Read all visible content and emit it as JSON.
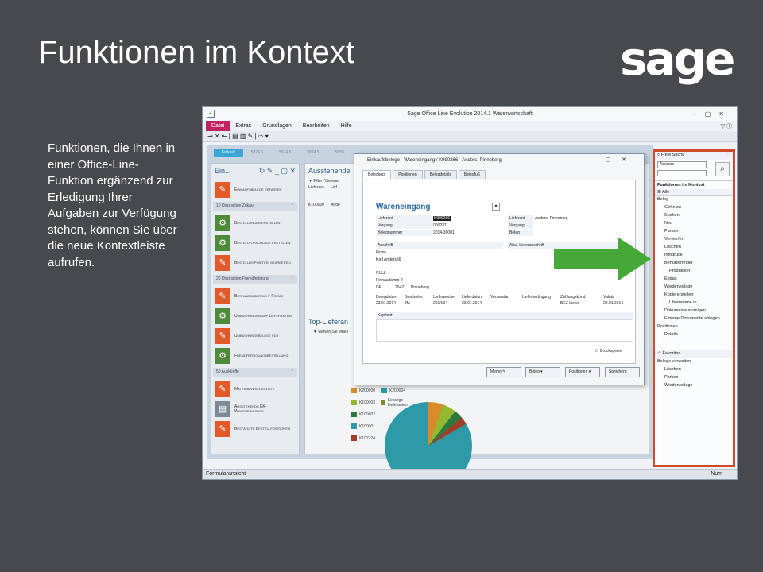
{
  "slide": {
    "title": "Funktionen im Kontext",
    "logo": "sage",
    "text": "Funktionen, die Ihnen in einer Office-Line-Funktion ergänzend zur Erledigung Ihrer Aufgaben zur Verfügung stehen, können Sie über die neue Kontextleiste aufrufen."
  },
  "app": {
    "title": "Sage Office Line Evolution 2014.1 Warenwirtschaft",
    "menu": [
      "Datei",
      "Extras",
      "Grundlagen",
      "Bearbeiten",
      "Hilfe"
    ],
    "status_left": "Formularansicht",
    "status_right": "Num"
  },
  "workarea": {
    "tabs": [
      "Einkauf",
      "5874.5",
      "5874.5",
      "5874.5",
      "5888"
    ],
    "left_panel": {
      "title": "Ein...",
      "top_tile": "Einkaufsbelege erfassen",
      "groups": [
        {
          "label": "10 Disposition Zukauf",
          "items": [
            "Bestellungen erstellen",
            "Bestellvorschläge erstellen",
            "Bestelldisposition bearbeiten"
          ]
        },
        {
          "label": "20 Disposition Fremdfertigung",
          "items": [
            "Bestandsübersicht Fremd",
            "Umbuchungen auf Lieferanten",
            "Umbuchungsbelege für",
            "Fremdfertigungsbestellung"
          ]
        },
        {
          "label": "50 Auskünfte",
          "items": [
            "Materialverzugsliste",
            "Ausstehende EK-Wareneingänge",
            "Bestätigte Bestellpositionen"
          ]
        }
      ]
    },
    "mid_panel": {
      "title": "Ausstehende",
      "filter": "Filter: 'Lieferan",
      "col_lieferant": "Lieferant",
      "col_lief": "Lief",
      "row_id": "K100000",
      "row_name": "Ande",
      "title2": "Top-Lieferan",
      "select_hint": "wählen Sie einen"
    },
    "legend": [
      [
        "K200000",
        "K200004"
      ],
      [
        "K100003",
        "Sonstige Lieferanten"
      ],
      [
        "K100002",
        ""
      ],
      [
        "K100001",
        ""
      ],
      [
        "K102224",
        ""
      ]
    ],
    "legend_colors": [
      [
        "#d98b2b",
        "#2e9aa8"
      ],
      [
        "#93b832",
        "#7d8a2a"
      ],
      [
        "#2e7a3c",
        ""
      ],
      [
        "#2e9aa8",
        ""
      ],
      [
        "#a43c2a",
        ""
      ]
    ]
  },
  "sidebar": {
    "search_head": "Freie Suche",
    "search_select": "Adresse",
    "context_head": "Funktionen im Kontext",
    "alle": "Alle",
    "items": [
      {
        "label": "Beleg",
        "level": 0
      },
      {
        "label": "Gehe zu",
        "level": 1
      },
      {
        "label": "Suchen",
        "level": 1
      },
      {
        "label": "Neu",
        "level": 1
      },
      {
        "label": "Parken",
        "level": 1
      },
      {
        "label": "Verwerfen",
        "level": 1
      },
      {
        "label": "Löschen",
        "level": 1
      },
      {
        "label": "Infodruck",
        "level": 1
      },
      {
        "label": "Benutzerfelder",
        "level": 1
      },
      {
        "label": "Produktion",
        "level": 2
      },
      {
        "label": "Extras",
        "level": 1
      },
      {
        "label": "Wiedervorlage",
        "level": 1
      },
      {
        "label": "Kopie erstellen",
        "level": 1
      },
      {
        "label": "Übernahme in",
        "level": 2
      },
      {
        "label": "Dokumente anzeigen",
        "level": 1
      },
      {
        "label": "Externe Dokumente ablegen",
        "level": 1
      },
      {
        "label": "Positionen",
        "level": 0
      },
      {
        "label": "Details",
        "level": 1
      }
    ],
    "fav_head": "Favoriten",
    "fav_items": [
      {
        "label": "Belege verwalten",
        "level": 0
      },
      {
        "label": "Löschen",
        "level": 1
      },
      {
        "label": "Parken",
        "level": 1
      },
      {
        "label": "Wiedervorlage",
        "level": 1
      }
    ]
  },
  "dialog": {
    "title": "Einkaufsbelege - Wareneingang / K990266 - Anders, Pinneberg",
    "tabs": [
      "Belegkopf",
      "Positionen",
      "Belegdetails",
      "Belegfuß"
    ],
    "heading": "Wareneingang",
    "lieferant_label": "Lieferant",
    "lieferant_value": "K990266",
    "vorgang_label": "Vorgang",
    "vorgang_value": "000237",
    "belegnummer_label": "Belegnummer",
    "belegnummer_value": "2014-30001",
    "r_lieferant_label": "Lieferant",
    "r_lieferant_value": "Anders, Pinneberg",
    "r_vorgang_label": "Vorgang",
    "r_beleg_label": "Beleg",
    "anschrift_label": "Anschrift",
    "abw_label": "Abw. Lieferanschrift",
    "firma": "Firma",
    "firma_name": "Karl Anders66",
    "null": "NULL",
    "street": "Pinnaudamm 2",
    "country": "DE",
    "zip": "25421",
    "city": "Pinneberg",
    "cols": [
      "Belegdatum",
      "Bearbeiter",
      "Lieferwoche",
      "Lieferdatum",
      "Versandart",
      "Lieferbedingung",
      "Zahlungskond.",
      "Valuta"
    ],
    "vals": [
      "23.01.2014",
      "JM",
      "2014/04",
      "23.01.2014",
      "",
      "",
      "BEZ Liefer",
      "23.01.2014"
    ],
    "kopftext": "Kopftext",
    "drucksperre": "Drucksperre",
    "buttons": [
      "Memo",
      "Beleg",
      "Positionen",
      "Speichern"
    ]
  }
}
